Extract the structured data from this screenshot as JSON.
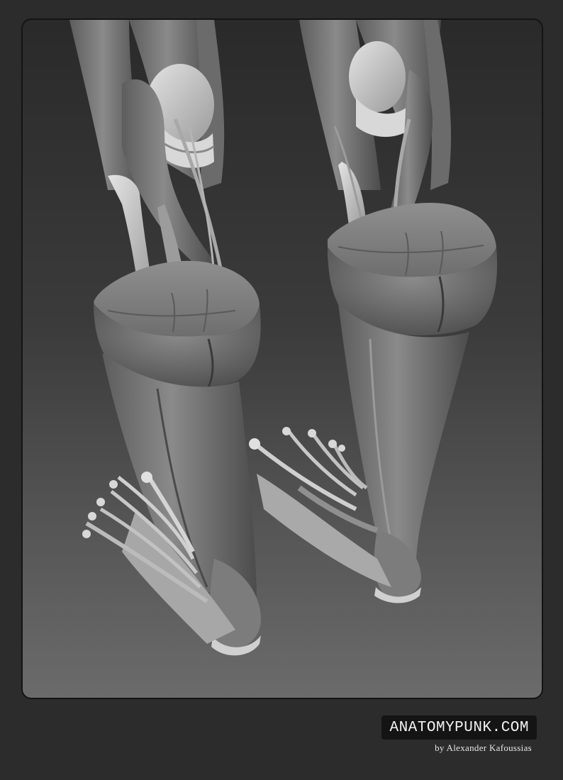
{
  "image": {
    "subject": "anatomy-render-lower-legs-and-feet",
    "background_color": "#2c2c2c",
    "frame_gradient_top": "#2a2a2a",
    "frame_gradient_bottom": "#6b6b6b",
    "muscle_tone": "#7d7d7d",
    "bone_tone": "#c9c9c9"
  },
  "branding": {
    "site_label": "ANATOMYPUNK.COM",
    "author_credit": "by Alexander Kafoussias",
    "badge_color": "#141414",
    "text_color": "#f2f2f2"
  }
}
